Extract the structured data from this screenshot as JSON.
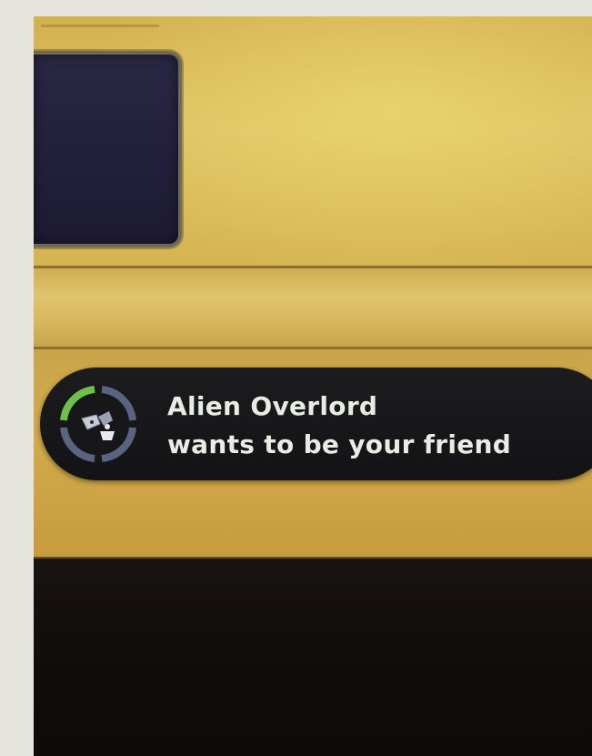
{
  "notification": {
    "sender": "Alien Overlord",
    "message": "wants to be your friend",
    "icon": "friend-request-icon",
    "progress_ring": {
      "filled_segments": 1,
      "total_segments": 4
    }
  },
  "colors": {
    "background_yellow": "#d6b452",
    "notification_bg": "#161618",
    "notification_text": "#e9ebe5",
    "ring_active": "#6fc04a",
    "ring_inactive": "#5a6480",
    "panel_dark": "#232039"
  }
}
